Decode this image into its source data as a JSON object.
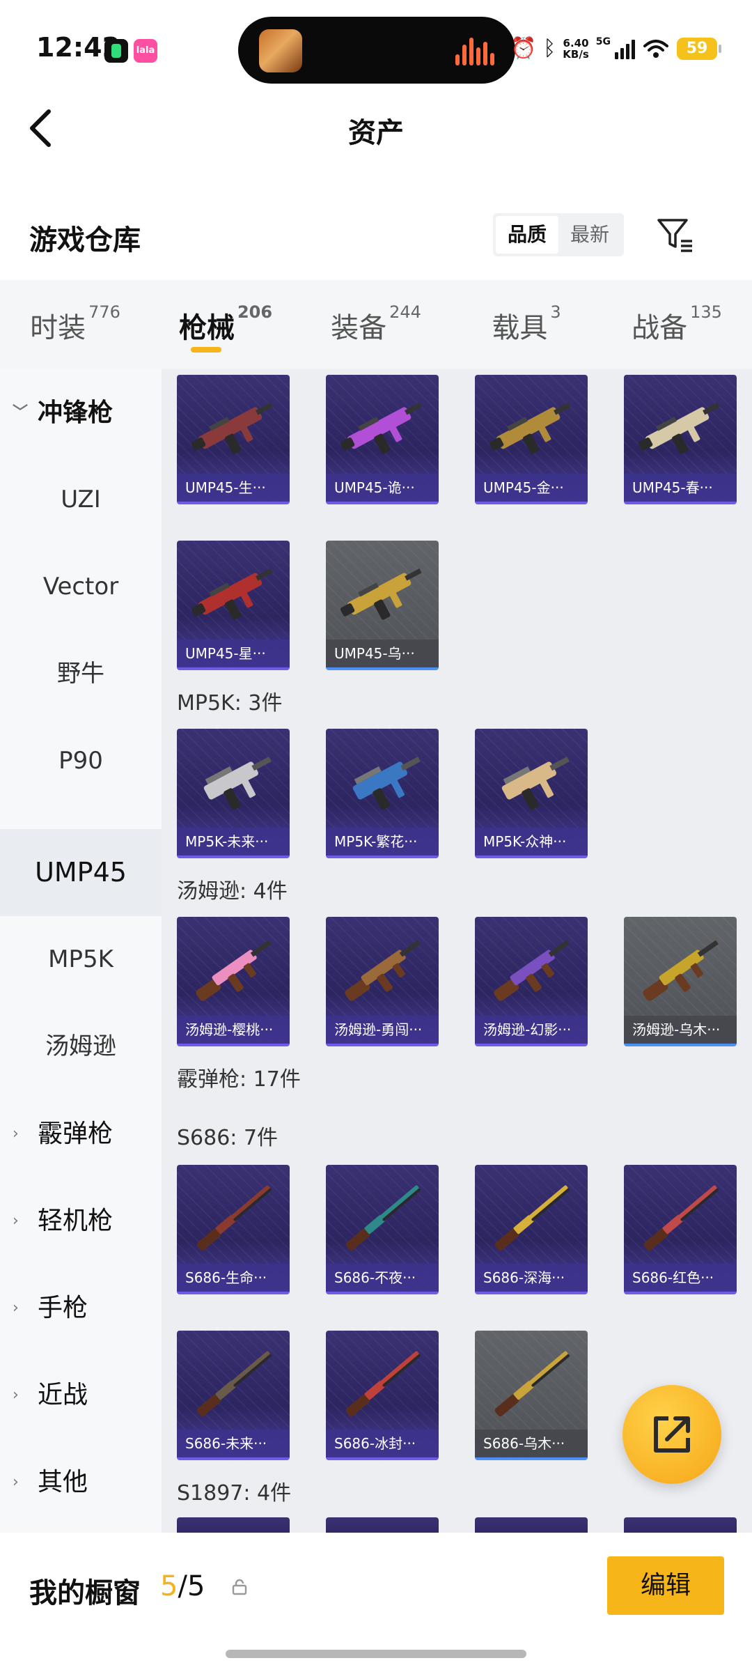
{
  "status_bar": {
    "time": "12:42",
    "app_badge": "lala",
    "net_speed_value": "6.40",
    "net_speed_unit": "KB/s",
    "network": "5G",
    "battery": "59",
    "icons": [
      "alarm-icon",
      "bluetooth-icon",
      "signal-icon",
      "wifi-icon"
    ]
  },
  "header": {
    "title": "资产"
  },
  "warehouse": {
    "title": "游戏仓库",
    "sort_options": [
      "品质",
      "最新"
    ],
    "active_sort": "品质"
  },
  "tabs": [
    {
      "label": "时装",
      "count": "776",
      "active": false
    },
    {
      "label": "枪械",
      "count": "206",
      "active": true
    },
    {
      "label": "装备",
      "count": "244",
      "active": false
    },
    {
      "label": "载具",
      "count": "3",
      "active": false
    },
    {
      "label": "战备",
      "count": "135",
      "active": false
    }
  ],
  "sidebar": {
    "items": [
      {
        "label": "冲锋枪",
        "type": "group",
        "expanded": true
      },
      {
        "label": "UZI",
        "type": "sub"
      },
      {
        "label": "Vector",
        "type": "sub"
      },
      {
        "label": "野牛",
        "type": "sub"
      },
      {
        "label": "P90",
        "type": "sub"
      },
      {
        "label": "UMP45",
        "type": "sub",
        "selected": true
      },
      {
        "label": "MP5K",
        "type": "sub"
      },
      {
        "label": "汤姆逊",
        "type": "sub"
      },
      {
        "label": "霰弹枪",
        "type": "group",
        "expanded": false
      },
      {
        "label": "轻机枪",
        "type": "group",
        "expanded": false
      },
      {
        "label": "手枪",
        "type": "group",
        "expanded": false
      },
      {
        "label": "近战",
        "type": "group",
        "expanded": false
      },
      {
        "label": "其他",
        "type": "group",
        "expanded": false
      }
    ]
  },
  "content": {
    "ump45_items": [
      "UMP45-生···",
      "UMP45-诡···",
      "UMP45-金···",
      "UMP45-春···",
      "UMP45-星···",
      "UMP45-乌···"
    ],
    "mp5k_title": "MP5K: 3件",
    "mp5k_items": [
      "MP5K-未来···",
      "MP5K-繁花···",
      "MP5K-众神···"
    ],
    "thompson_title": "汤姆逊: 4件",
    "thompson_items": [
      "汤姆逊-樱桃···",
      "汤姆逊-勇闯···",
      "汤姆逊-幻影···",
      "汤姆逊-乌木···"
    ],
    "shotgun_title": "霰弹枪: 17件",
    "s686_title": "S686: 7件",
    "s686_items": [
      "S686-生命···",
      "S686-不夜···",
      "S686-深海···",
      "S686-红色···",
      "S686-未来···",
      "S686-冰封···",
      "S686-乌木···"
    ],
    "s1897_title": "S1897: 4件"
  },
  "bottom_bar": {
    "window_label": "我的橱窗",
    "window_used": "5",
    "window_sep": "/",
    "window_total": "5",
    "edit_label": "编辑"
  },
  "colors": {
    "accent": "#f6b61a",
    "card_purple": "#2c2560",
    "card_grey": "#55585d"
  }
}
